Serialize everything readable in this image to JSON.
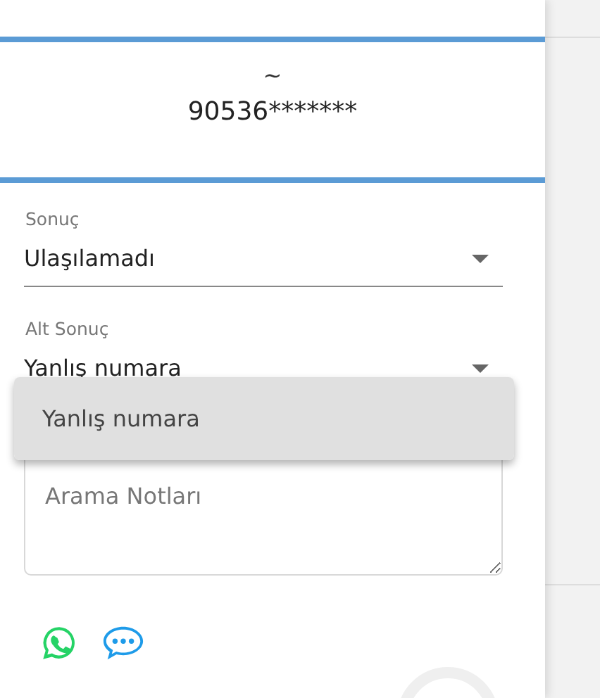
{
  "contact": {
    "name": "~",
    "phone": "90536*******"
  },
  "fields": [
    {
      "kind": "select",
      "label": "Sonuç",
      "value": "Ulaşılamadı"
    },
    {
      "kind": "select",
      "label": "Alt Sonuç",
      "value": "Yanlış numara"
    }
  ],
  "menu": {
    "options": [
      {
        "label": "Yanlış numara",
        "selected": true
      }
    ]
  },
  "notes": {
    "placeholder": "Arama Notları"
  }
}
